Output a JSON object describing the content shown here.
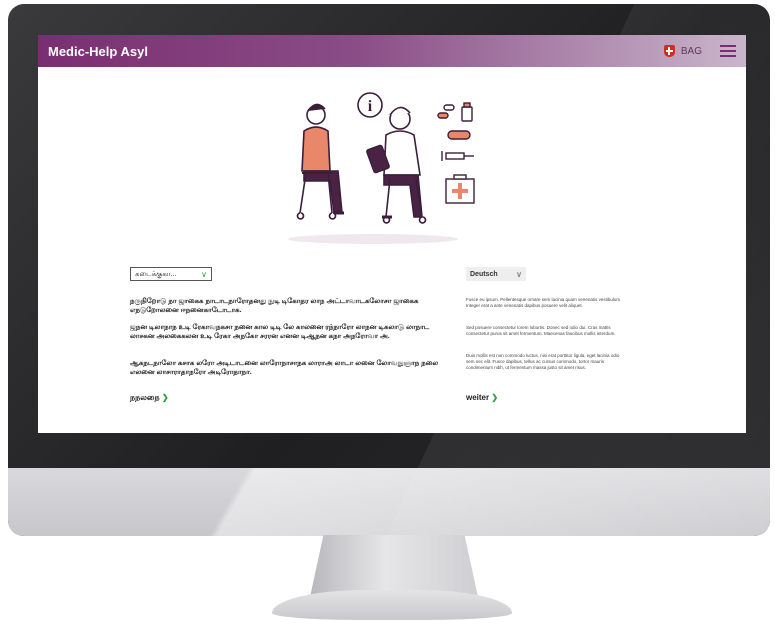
{
  "header": {
    "brand": "Medic-Help Asyl",
    "agency": "BAG"
  },
  "left": {
    "language_select": "கடைக்குகா...",
    "paragraphs": [
      "நருநிறோடு நா ஜாகைக நாடாடநாரோதனது நுடி டிகோதர லாந அட்டாவாடகலோசா ஜாகைக எநடுறோலனை ஈநனைகாடோடாக.",
      "ஜநன டிலாநாந உடி ரேகாவநகசா நனை கால டிடி லே காலனை ரந்நாரோ லாநன டிகலாடு லாநாட லாசகன அலகைகலன உடி ரேகா அநகோ சரரன எனன டிஆநன கநா அநரோவா அ.",
      "ஆகநடநாலோ கசாக லரோ அடிடாடனை லாரோநாசாநக லாராஅ லாடா லனை லோவநுஞாந நலை எலனை லாசாராதாநரோ அடிரோதாநா."
    ],
    "link": "நநலநை"
  },
  "right": {
    "language_select": "Deutsch",
    "paragraphs": [
      "Fusce eu ipsum. Pellentesque ornare sem lacinia quam venenatis vestibulum. Integer erat a ante venenatis dapibus posuere velit aliquet.",
      "Sed posuere consectetur lorem lobortis. Donec sed odio dui. Cras mattis consectetur purus sit amet fermentum. Maecenas faucibus mollis interdum.",
      "Duis mollis est non commodo luctus, nisi erat porttitor ligula, eget lacinia odio sem nec elit. Fusce dapibus, tellus ac cursus commodo, tortor mauris condimentum nibh, ut fermentum massa justo sit amet risus."
    ],
    "link": "weiter"
  },
  "colors": {
    "brand": "#7a2e72",
    "accent_green": "#2e9d3a",
    "illustration_orange": "#e8876a"
  },
  "icons": [
    "swiss-cross-icon",
    "menu-icon",
    "info-icon",
    "pills-icon",
    "medicine-bottle-icon",
    "bandage-icon",
    "syringe-icon",
    "first-aid-kit-icon",
    "chevron-down-icon",
    "chevron-right-icon"
  ]
}
